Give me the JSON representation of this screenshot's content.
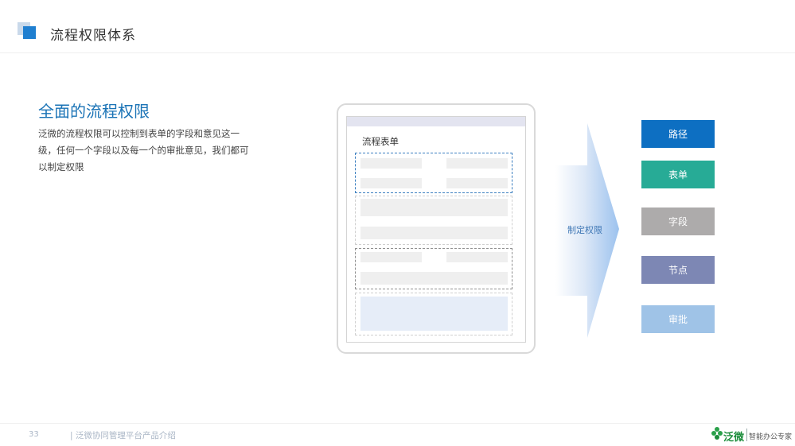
{
  "header": {
    "title": "流程权限体系"
  },
  "content": {
    "subtitle": "全面的流程权限",
    "description": "泛微的流程权限可以控制到表单的字段和意见这一级，任何一个字段以及每一个的审批意见，我们都可以制定权限"
  },
  "mockup": {
    "form_title": "流程表单"
  },
  "arrow": {
    "label": "制定权限"
  },
  "categories": [
    {
      "label": "路径",
      "color": "#0d6fc2"
    },
    {
      "label": "表单",
      "color": "#27ab96"
    },
    {
      "label": "字段",
      "color": "#adabab"
    },
    {
      "label": "节点",
      "color": "#7d87b4"
    },
    {
      "label": "审批",
      "color": "#9fc3e7"
    }
  ],
  "footer": {
    "page_number": "33",
    "text": "| 泛微协同管理平台产品介绍",
    "logo_text": "泛微",
    "slogan": "智能办公专家"
  }
}
